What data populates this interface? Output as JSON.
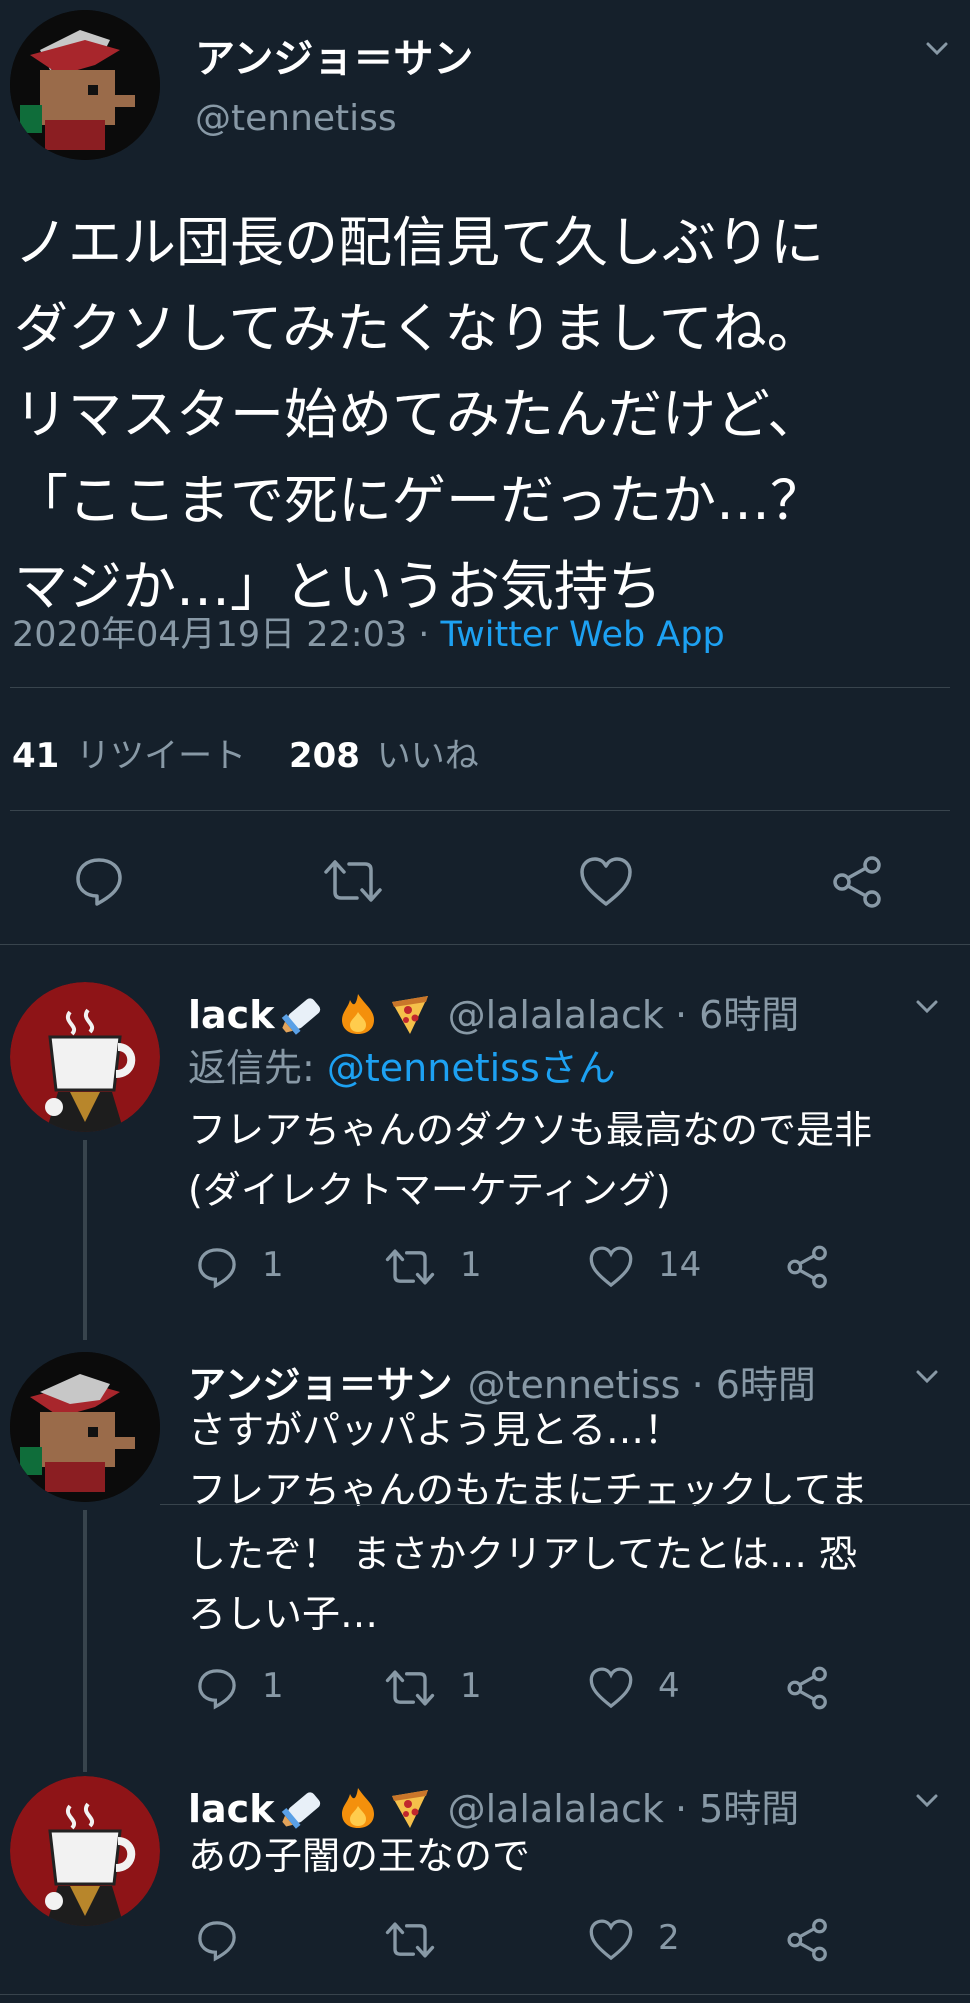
{
  "tweet": {
    "display_name": "アンジョ＝サン",
    "handle": "@tennetiss",
    "text_lines": [
      "ノエル団長の配信見て久しぶりに",
      "ダクソしてみたくなりましてね。",
      "リマスター始めてみたんだけど、",
      "「ここまで死にゲーだったか…？",
      "マジか…」というお気持ち"
    ],
    "timestamp": "2020年04月19日 22:03",
    "separator": " · ",
    "source": "Twitter Web App",
    "retweet_count": "41",
    "retweet_label": "リツイート",
    "like_count": "208",
    "like_label": "いいね"
  },
  "replies": [
    {
      "display_name": "lack",
      "emojis": [
        "baby-bottle",
        "fire",
        "pizza"
      ],
      "handle": "@lalalalack",
      "time": "· 6時間",
      "reply_to_label": "返信先: ",
      "reply_to_handle": "@tennetissさん",
      "text_lines": [
        "フレアちゃんのダクソも最高なので是非",
        "(ダイレクトマーケティング)"
      ],
      "reply_count": "1",
      "retweet_count": "1",
      "like_count": "14"
    },
    {
      "display_name": "アンジョ＝サン",
      "handle": "@tennetiss",
      "time": "· 6時間",
      "text_lines": [
        "さすがパッパよう見とる…！",
        "フレアちゃんのもたまにチェックしてま",
        "したぞ！ まさかクリアしてたとは… 恐",
        "ろしい子…"
      ],
      "reply_count": "1",
      "retweet_count": "1",
      "like_count": "4"
    },
    {
      "display_name": "lack",
      "emojis": [
        "baby-bottle",
        "fire",
        "pizza"
      ],
      "handle": "@lalalalack",
      "time": "· 5時間",
      "text_lines": [
        "あの子闇の王なので"
      ],
      "reply_count": "",
      "retweet_count": "",
      "like_count": "2"
    }
  ],
  "colors": {
    "background": "#15202b",
    "muted": "#8899a6",
    "link": "#1da1f2",
    "divider": "#38444d"
  }
}
